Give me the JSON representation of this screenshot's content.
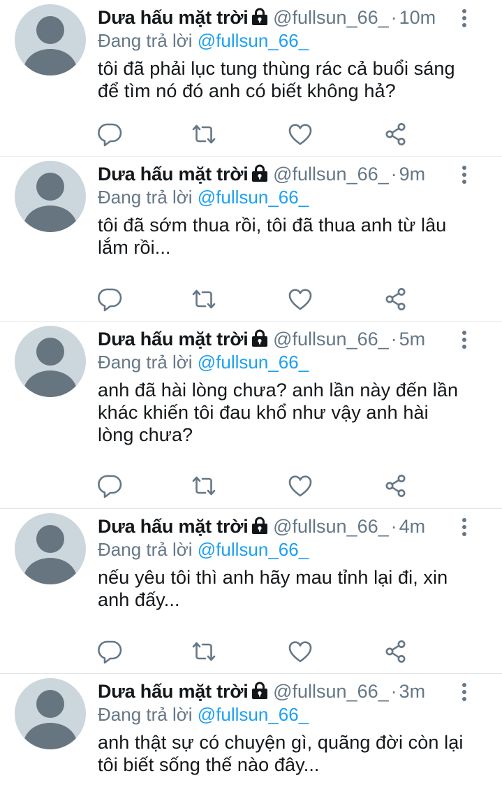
{
  "colors": {
    "text": "#14171a",
    "muted": "#657786",
    "link": "#1da1f2",
    "avatar_bg": "#ccd6dd",
    "avatar_fg": "#66757f",
    "divider": "#e3e6e8"
  },
  "icons": {
    "lock": "lock-icon",
    "more": "more-vertical-icon",
    "reply": "reply-icon",
    "retweet": "retweet-icon",
    "like": "heart-icon",
    "share": "share-icon"
  },
  "tweets": [
    {
      "name": "Dưa hấu mặt trời",
      "handle": "@fullsun_66_",
      "dot": "·",
      "time": "10m",
      "reply_label": "Đang trả lời",
      "reply_handle": "@fullsun_66_",
      "text_lines": [
        "tôi đã phải lục tung thùng rác cả buổi sáng",
        "để tìm nó đó anh có biết không hả?"
      ]
    },
    {
      "name": "Dưa hấu mặt trời",
      "handle": "@fullsun_66_",
      "dot": "·",
      "time": "9m",
      "reply_label": "Đang trả lời",
      "reply_handle": "@fullsun_66_",
      "text_lines": [
        "tôi đã sớm thua rồi, tôi đã thua anh từ lâu",
        "lắm rồi..."
      ]
    },
    {
      "name": "Dưa hấu mặt trời",
      "handle": "@fullsun_66_",
      "dot": "·",
      "time": "5m",
      "reply_label": "Đang trả lời",
      "reply_handle": "@fullsun_66_",
      "text_lines": [
        "anh đã hài lòng chưa? anh lần này đến lần",
        "khác khiến tôi đau khổ như vậy anh hài",
        "lòng chưa?"
      ]
    },
    {
      "name": "Dưa hấu mặt trời",
      "handle": "@fullsun_66_",
      "dot": "·",
      "time": "4m",
      "reply_label": "Đang trả lời",
      "reply_handle": "@fullsun_66_",
      "text_lines": [
        "nếu yêu tôi thì anh hãy mau tỉnh lại đi, xin",
        "anh đấy..."
      ]
    },
    {
      "name": "Dưa hấu mặt trời",
      "handle": "@fullsun_66_",
      "dot": "·",
      "time": "3m",
      "reply_label": "Đang trả lời",
      "reply_handle": "@fullsun_66_",
      "text_lines": [
        "anh thật sự có chuyện gì, quãng đời còn lại",
        "tôi biết sống thế nào đây..."
      ]
    }
  ]
}
